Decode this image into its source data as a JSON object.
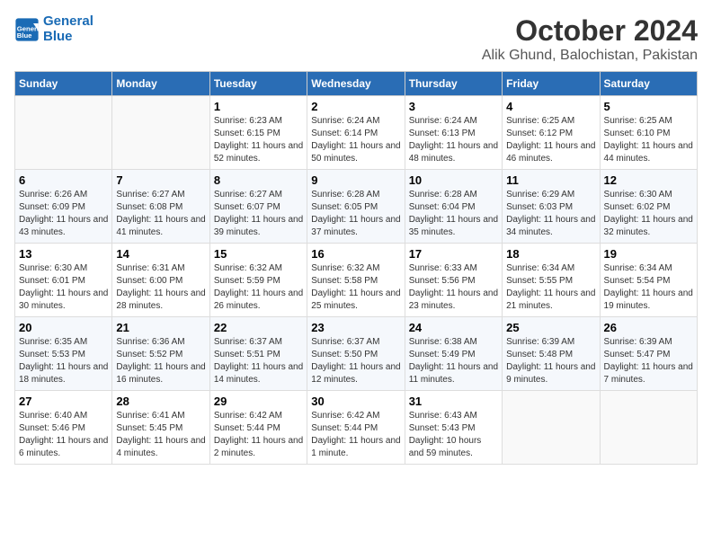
{
  "header": {
    "logo_line1": "General",
    "logo_line2": "Blue",
    "month": "October 2024",
    "location": "Alik Ghund, Balochistan, Pakistan"
  },
  "weekdays": [
    "Sunday",
    "Monday",
    "Tuesday",
    "Wednesday",
    "Thursday",
    "Friday",
    "Saturday"
  ],
  "weeks": [
    [
      {
        "day": "",
        "info": ""
      },
      {
        "day": "",
        "info": ""
      },
      {
        "day": "1",
        "info": "Sunrise: 6:23 AM\nSunset: 6:15 PM\nDaylight: 11 hours and 52 minutes."
      },
      {
        "day": "2",
        "info": "Sunrise: 6:24 AM\nSunset: 6:14 PM\nDaylight: 11 hours and 50 minutes."
      },
      {
        "day": "3",
        "info": "Sunrise: 6:24 AM\nSunset: 6:13 PM\nDaylight: 11 hours and 48 minutes."
      },
      {
        "day": "4",
        "info": "Sunrise: 6:25 AM\nSunset: 6:12 PM\nDaylight: 11 hours and 46 minutes."
      },
      {
        "day": "5",
        "info": "Sunrise: 6:25 AM\nSunset: 6:10 PM\nDaylight: 11 hours and 44 minutes."
      }
    ],
    [
      {
        "day": "6",
        "info": "Sunrise: 6:26 AM\nSunset: 6:09 PM\nDaylight: 11 hours and 43 minutes."
      },
      {
        "day": "7",
        "info": "Sunrise: 6:27 AM\nSunset: 6:08 PM\nDaylight: 11 hours and 41 minutes."
      },
      {
        "day": "8",
        "info": "Sunrise: 6:27 AM\nSunset: 6:07 PM\nDaylight: 11 hours and 39 minutes."
      },
      {
        "day": "9",
        "info": "Sunrise: 6:28 AM\nSunset: 6:05 PM\nDaylight: 11 hours and 37 minutes."
      },
      {
        "day": "10",
        "info": "Sunrise: 6:28 AM\nSunset: 6:04 PM\nDaylight: 11 hours and 35 minutes."
      },
      {
        "day": "11",
        "info": "Sunrise: 6:29 AM\nSunset: 6:03 PM\nDaylight: 11 hours and 34 minutes."
      },
      {
        "day": "12",
        "info": "Sunrise: 6:30 AM\nSunset: 6:02 PM\nDaylight: 11 hours and 32 minutes."
      }
    ],
    [
      {
        "day": "13",
        "info": "Sunrise: 6:30 AM\nSunset: 6:01 PM\nDaylight: 11 hours and 30 minutes."
      },
      {
        "day": "14",
        "info": "Sunrise: 6:31 AM\nSunset: 6:00 PM\nDaylight: 11 hours and 28 minutes."
      },
      {
        "day": "15",
        "info": "Sunrise: 6:32 AM\nSunset: 5:59 PM\nDaylight: 11 hours and 26 minutes."
      },
      {
        "day": "16",
        "info": "Sunrise: 6:32 AM\nSunset: 5:58 PM\nDaylight: 11 hours and 25 minutes."
      },
      {
        "day": "17",
        "info": "Sunrise: 6:33 AM\nSunset: 5:56 PM\nDaylight: 11 hours and 23 minutes."
      },
      {
        "day": "18",
        "info": "Sunrise: 6:34 AM\nSunset: 5:55 PM\nDaylight: 11 hours and 21 minutes."
      },
      {
        "day": "19",
        "info": "Sunrise: 6:34 AM\nSunset: 5:54 PM\nDaylight: 11 hours and 19 minutes."
      }
    ],
    [
      {
        "day": "20",
        "info": "Sunrise: 6:35 AM\nSunset: 5:53 PM\nDaylight: 11 hours and 18 minutes."
      },
      {
        "day": "21",
        "info": "Sunrise: 6:36 AM\nSunset: 5:52 PM\nDaylight: 11 hours and 16 minutes."
      },
      {
        "day": "22",
        "info": "Sunrise: 6:37 AM\nSunset: 5:51 PM\nDaylight: 11 hours and 14 minutes."
      },
      {
        "day": "23",
        "info": "Sunrise: 6:37 AM\nSunset: 5:50 PM\nDaylight: 11 hours and 12 minutes."
      },
      {
        "day": "24",
        "info": "Sunrise: 6:38 AM\nSunset: 5:49 PM\nDaylight: 11 hours and 11 minutes."
      },
      {
        "day": "25",
        "info": "Sunrise: 6:39 AM\nSunset: 5:48 PM\nDaylight: 11 hours and 9 minutes."
      },
      {
        "day": "26",
        "info": "Sunrise: 6:39 AM\nSunset: 5:47 PM\nDaylight: 11 hours and 7 minutes."
      }
    ],
    [
      {
        "day": "27",
        "info": "Sunrise: 6:40 AM\nSunset: 5:46 PM\nDaylight: 11 hours and 6 minutes."
      },
      {
        "day": "28",
        "info": "Sunrise: 6:41 AM\nSunset: 5:45 PM\nDaylight: 11 hours and 4 minutes."
      },
      {
        "day": "29",
        "info": "Sunrise: 6:42 AM\nSunset: 5:44 PM\nDaylight: 11 hours and 2 minutes."
      },
      {
        "day": "30",
        "info": "Sunrise: 6:42 AM\nSunset: 5:44 PM\nDaylight: 11 hours and 1 minute."
      },
      {
        "day": "31",
        "info": "Sunrise: 6:43 AM\nSunset: 5:43 PM\nDaylight: 10 hours and 59 minutes."
      },
      {
        "day": "",
        "info": ""
      },
      {
        "day": "",
        "info": ""
      }
    ]
  ]
}
